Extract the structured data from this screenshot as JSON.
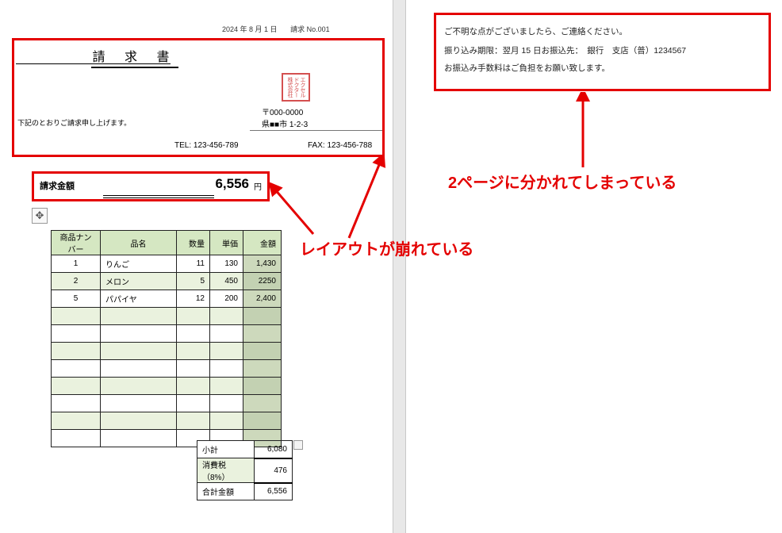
{
  "meta": {
    "date": "2024 年 8 月 1 日",
    "doc_no": "請求 No.001"
  },
  "title": "請  求  書",
  "note_left": "下記のとおりご請求申し上げます。",
  "stamp": "エクセル\nドクター\n株式会社",
  "addr": {
    "postal": "〒000-0000",
    "line": "県■■市 1-2-3"
  },
  "contacts": {
    "tel_label": "TEL: 123-456-789",
    "fax_label": "FAX: 123-456-788"
  },
  "billing": {
    "label": "請求金額",
    "amount": "6,556",
    "yen": "円"
  },
  "items_table": {
    "headers": [
      "商品ナンバー",
      "品名",
      "数量",
      "単価",
      "金額"
    ],
    "rows": [
      {
        "num": "1",
        "name": "りんご",
        "qty": "11",
        "price": "130",
        "amt": "1,430"
      },
      {
        "num": "2",
        "name": "メロン",
        "qty": "5",
        "price": "450",
        "amt": "2250"
      },
      {
        "num": "5",
        "name": "パパイヤ",
        "qty": "12",
        "price": "200",
        "amt": "2,400"
      }
    ],
    "empty_rows": 8
  },
  "totals": {
    "subtotal_label": "小計",
    "subtotal": "6,080",
    "tax_label": "消費税（8%）",
    "tax": "476",
    "total_label": "合計金額",
    "total": "6,556"
  },
  "page2": {
    "line1": "ご不明な点がございましたら、ご連絡ください。",
    "line2": "振り込み期限：翌月 15 日お振込先：　銀行　支店（普）1234567",
    "line3": "お振込み手数料はご負担をお願い致します。"
  },
  "callouts": {
    "broken_layout": "レイアウトが崩れている",
    "split_pages": "2ページに分かれてしまっている"
  },
  "icons": {
    "move": "✥"
  }
}
